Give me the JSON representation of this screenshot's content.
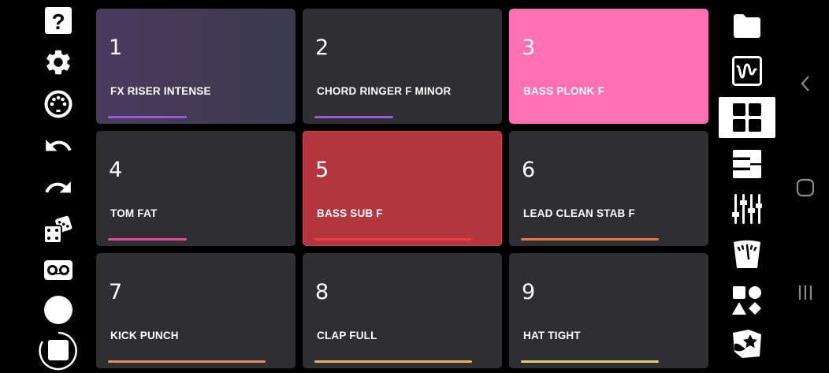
{
  "left_toolbar": {
    "icons": [
      "help-icon",
      "settings-icon",
      "midi-icon",
      "undo-icon",
      "redo-icon",
      "dice-icon",
      "tape-icon",
      "record-icon",
      "stop-icon"
    ]
  },
  "pads": [
    {
      "number": "1",
      "name": "FX RISER INTENSE",
      "bg": "#463a57",
      "bar_color": "#9b59d9",
      "bar_length": 0.4
    },
    {
      "number": "2",
      "name": "CHORD RINGER F MINOR",
      "bg": "#2f2f33",
      "bar_color": "#9b59d9",
      "bar_length": 0.4
    },
    {
      "number": "3",
      "name": "BASS PLONK F",
      "bg": "#ff71b3",
      "bar_color": "#ff71b3",
      "bar_length": 0.4
    },
    {
      "number": "4",
      "name": "TOM FAT",
      "bg": "#2f2f33",
      "bar_color": "#e0508f",
      "bar_length": 0.4
    },
    {
      "number": "5",
      "name": "BASS SUB F",
      "bg": "#b3363f",
      "bar_color": "#ef3b44",
      "bar_length": 0.8
    },
    {
      "number": "6",
      "name": "LEAD CLEAN STAB F",
      "bg": "#2f2f33",
      "bar_color": "#e07a4a",
      "bar_length": 0.7
    },
    {
      "number": "7",
      "name": "KICK PUNCH",
      "bg": "#2f2f33",
      "bar_color": "#e58c66",
      "bar_length": 0.8
    },
    {
      "number": "8",
      "name": "CLAP FULL",
      "bg": "#2f2f33",
      "bar_color": "#e8b066",
      "bar_length": 0.8
    },
    {
      "number": "9",
      "name": "HAT TIGHT",
      "bg": "#2f2f33",
      "bar_color": "#d9cf7a",
      "bar_length": 0.7
    }
  ],
  "right_toolbar": {
    "icons": [
      "folder-icon",
      "waveform-icon",
      "pads-grid-icon",
      "keyboard-icon",
      "mixer-icon",
      "tuner-icon",
      "shapes-icon",
      "fx-star-icon"
    ],
    "active": "pads-grid-icon"
  },
  "android_nav": {
    "icons": [
      "back-icon",
      "home-icon",
      "recents-icon"
    ]
  },
  "colors": {
    "pad_default": "#2f2f33",
    "background": "#000000",
    "icon": "#ffffff"
  }
}
